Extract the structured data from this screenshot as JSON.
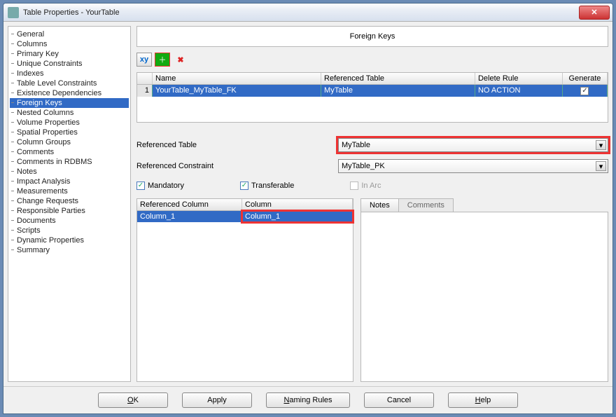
{
  "window": {
    "title": "Table Properties - YourTable"
  },
  "sidebar": {
    "items": [
      "General",
      "Columns",
      "Primary Key",
      "Unique Constraints",
      "Indexes",
      "Table Level Constraints",
      "Existence Dependencies",
      "Foreign Keys",
      "Nested Columns",
      "Volume Properties",
      "Spatial Properties",
      "Column Groups",
      "Comments",
      "Comments in RDBMS",
      "Notes",
      "Impact Analysis",
      "Measurements",
      "Change Requests",
      "Responsible Parties",
      "Documents",
      "Scripts",
      "Dynamic Properties",
      "Summary"
    ],
    "selected_index": 7
  },
  "panel_title": "Foreign Keys",
  "toolbar": {
    "icons": [
      "xy-icon",
      "add-icon",
      "delete-icon"
    ]
  },
  "fk_grid": {
    "headers": {
      "idx": "",
      "name": "Name",
      "ref": "Referenced Table",
      "del": "Delete Rule",
      "gen": "Generate"
    },
    "rows": [
      {
        "idx": "1",
        "name": "YourTable_MyTable_FK",
        "ref": "MyTable",
        "del": "NO ACTION",
        "gen": true
      }
    ]
  },
  "form": {
    "ref_table_label": "Referenced Table",
    "ref_table_value": "MyTable",
    "ref_constraint_label": "Referenced Constraint",
    "ref_constraint_value": "MyTable_PK",
    "mandatory_label": "Mandatory",
    "mandatory": true,
    "transferable_label": "Transferable",
    "transferable": true,
    "in_arc_label": "In Arc",
    "in_arc": false
  },
  "col_grid": {
    "headers": {
      "ref": "Referenced Column",
      "col": "Column"
    },
    "rows": [
      {
        "ref": "Column_1",
        "col": "Column_1"
      }
    ]
  },
  "tabs": {
    "notes": "Notes",
    "comments": "Comments",
    "active": 0
  },
  "footer": {
    "ok": "OK",
    "apply": "Apply",
    "naming": "Naming Rules",
    "cancel": "Cancel",
    "help": "Help"
  }
}
